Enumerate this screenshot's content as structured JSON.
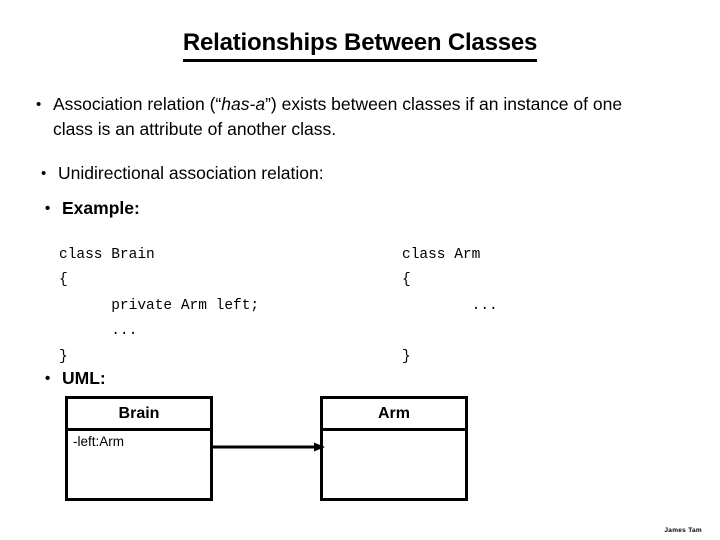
{
  "slide": {
    "title": "Relationships Between Classes",
    "bullets": [
      {
        "id": "association",
        "marker": "•",
        "pre": "Association relation (“",
        "emphasis": "has-a",
        "post": "”) exists between classes if an instance of one class is an attribute of another class."
      },
      {
        "id": "unidirectional",
        "marker": "•",
        "text": "Unidirectional association relation:"
      },
      {
        "id": "example",
        "marker": "•",
        "text": "Example:"
      },
      {
        "id": "uml",
        "marker": "•",
        "text": "UML:"
      }
    ],
    "code_blocks": [
      {
        "id": "brain",
        "text": "class Brain\n{\n      private Arm left;\n      ...\n}"
      },
      {
        "id": "arm",
        "text": "class Arm\n{\n        ...\n\n}"
      }
    ],
    "uml": {
      "boxes": [
        {
          "id": "brain",
          "name": "Brain",
          "attributes": "-left:Arm"
        },
        {
          "id": "arm",
          "name": "Arm",
          "attributes": ""
        }
      ],
      "relation": {
        "type": "unidirectional-association",
        "from": "Brain",
        "to": "Arm",
        "arrow_label": ""
      }
    },
    "footer_credit": "James Tam"
  }
}
